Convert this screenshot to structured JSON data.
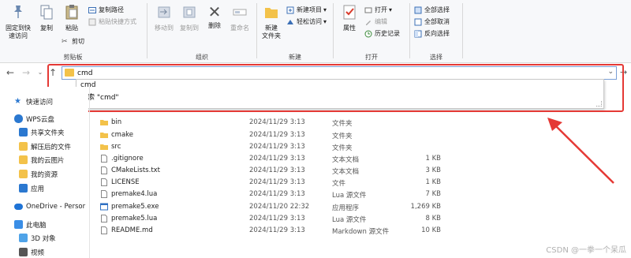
{
  "ribbon": {
    "clipboard": {
      "label": "剪贴板",
      "pin": "固定到快\n速访问",
      "copy": "复制",
      "paste": "粘贴",
      "copy_path": "复制路径",
      "paste_shortcut": "粘贴快捷方式",
      "cut": "剪切"
    },
    "organize": {
      "label": "组织",
      "move_to": "移动到",
      "copy_to": "复制到",
      "delete": "删除",
      "rename": "重命名"
    },
    "new": {
      "label": "新建",
      "new_folder": "新建\n文件夹",
      "new_item": "新建项目",
      "easy_access": "轻松访问"
    },
    "open": {
      "label": "打开",
      "properties": "属性",
      "open": "打开",
      "edit": "编辑",
      "history": "历史记录"
    },
    "select": {
      "label": "选择",
      "select_all": "全部选择",
      "select_none": "全部取消",
      "invert": "反向选择"
    }
  },
  "address": {
    "value": "cmd",
    "suggestions": [
      "cmd",
      "搜索 \"cmd\""
    ]
  },
  "nav": [
    {
      "label": "快速访问",
      "icon": "star-icon",
      "color": "#2b78d0"
    },
    {
      "label": "WPS云盘",
      "icon": "cloud-icon",
      "color": "#2b78d0"
    },
    {
      "label": "共享文件夹",
      "icon": "shared-folder-icon",
      "color": "#2b78d0"
    },
    {
      "label": "解压后的文件",
      "icon": "folder-icon",
      "color": "#f3c24a"
    },
    {
      "label": "我的云图片",
      "icon": "folder-icon",
      "color": "#f3c24a"
    },
    {
      "label": "我的资源",
      "icon": "folder-icon",
      "color": "#f3c24a"
    },
    {
      "label": "应用",
      "icon": "apps-icon",
      "color": "#2b78d0"
    },
    {
      "label": "OneDrive - Persor",
      "icon": "onedrive-icon",
      "color": "#1e73d6"
    },
    {
      "label": "此电脑",
      "icon": "pc-icon",
      "color": "#3a8ee6"
    },
    {
      "label": "3D 对象",
      "icon": "cube-icon",
      "color": "#4fa3e8"
    },
    {
      "label": "视频",
      "icon": "video-icon",
      "color": "#555555"
    }
  ],
  "files": [
    {
      "name": "bin",
      "date": "2024/11/29 3:13",
      "type": "文件夹",
      "size": "",
      "icon": "folder-icon",
      "color": "#f3c24a"
    },
    {
      "name": "cmake",
      "date": "2024/11/29 3:13",
      "type": "文件夹",
      "size": "",
      "icon": "folder-icon",
      "color": "#f3c24a"
    },
    {
      "name": "src",
      "date": "2024/11/29 3:13",
      "type": "文件夹",
      "size": "",
      "icon": "folder-icon",
      "color": "#f3c24a"
    },
    {
      "name": ".gitignore",
      "date": "2024/11/29 3:13",
      "type": "文本文档",
      "size": "1 KB",
      "icon": "document-icon",
      "color": "#ffffff"
    },
    {
      "name": "CMakeLists.txt",
      "date": "2024/11/29 3:13",
      "type": "文本文档",
      "size": "3 KB",
      "icon": "document-icon",
      "color": "#ffffff"
    },
    {
      "name": "LICENSE",
      "date": "2024/11/29 3:13",
      "type": "文件",
      "size": "1 KB",
      "icon": "document-icon",
      "color": "#ffffff"
    },
    {
      "name": "premake4.lua",
      "date": "2024/11/29 3:13",
      "type": "Lua 源文件",
      "size": "7 KB",
      "icon": "document-icon",
      "color": "#ffffff"
    },
    {
      "name": "premake5.exe",
      "date": "2024/11/20 22:32",
      "type": "应用程序",
      "size": "1,269 KB",
      "icon": "exe-icon",
      "color": "#2e6fc2"
    },
    {
      "name": "premake5.lua",
      "date": "2024/11/29 3:13",
      "type": "Lua 源文件",
      "size": "8 KB",
      "icon": "document-icon",
      "color": "#ffffff"
    },
    {
      "name": "README.md",
      "date": "2024/11/29 3:13",
      "type": "Markdown 源文件",
      "size": "10 KB",
      "icon": "document-icon",
      "color": "#ffffff"
    }
  ],
  "watermark": "CSDN @一拳一个呆瓜",
  "colors": {
    "highlight": "#e53935",
    "accent": "#2b78d0",
    "folder": "#f3c24a"
  }
}
